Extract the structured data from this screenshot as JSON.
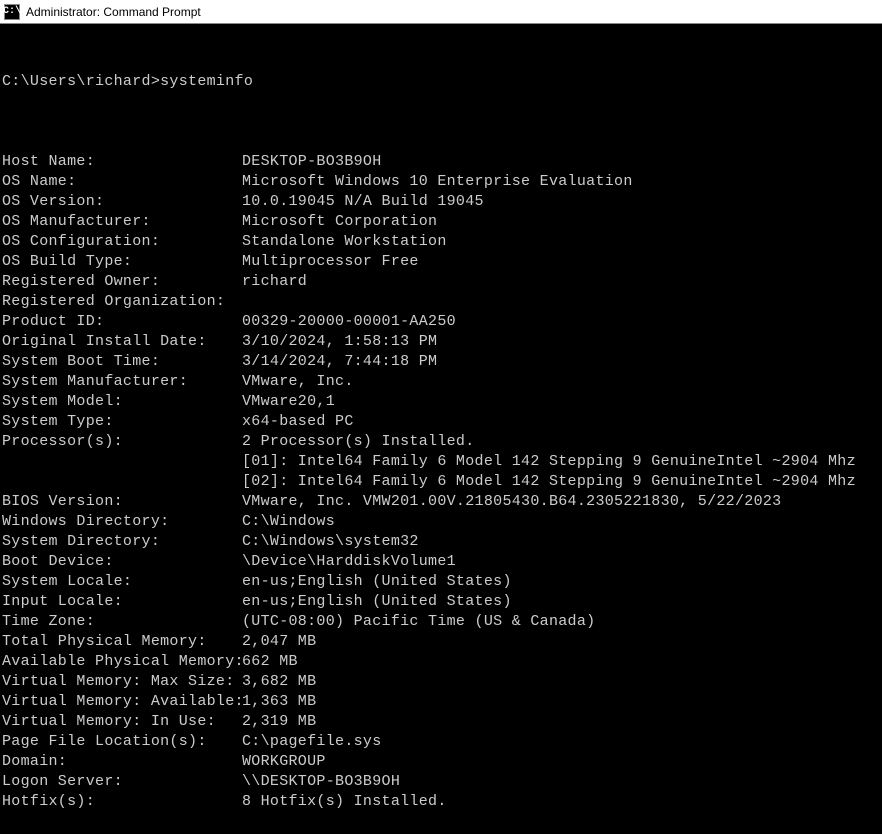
{
  "titlebar": {
    "icon_text": "C:\\",
    "title": "Administrator: Command Prompt"
  },
  "prompt": "C:\\Users\\richard>",
  "command": "systeminfo",
  "rows": [
    {
      "label": "Host Name:",
      "value": "DESKTOP-BO3B9OH"
    },
    {
      "label": "OS Name:",
      "value": "Microsoft Windows 10 Enterprise Evaluation"
    },
    {
      "label": "OS Version:",
      "value": "10.0.19045 N/A Build 19045"
    },
    {
      "label": "OS Manufacturer:",
      "value": "Microsoft Corporation"
    },
    {
      "label": "OS Configuration:",
      "value": "Standalone Workstation"
    },
    {
      "label": "OS Build Type:",
      "value": "Multiprocessor Free"
    },
    {
      "label": "Registered Owner:",
      "value": "richard"
    },
    {
      "label": "Registered Organization:",
      "value": ""
    },
    {
      "label": "Product ID:",
      "value": "00329-20000-00001-AA250"
    },
    {
      "label": "Original Install Date:",
      "value": "3/10/2024, 1:58:13 PM"
    },
    {
      "label": "System Boot Time:",
      "value": "3/14/2024, 7:44:18 PM"
    },
    {
      "label": "System Manufacturer:",
      "value": "VMware, Inc."
    },
    {
      "label": "System Model:",
      "value": "VMware20,1"
    },
    {
      "label": "System Type:",
      "value": "x64-based PC"
    },
    {
      "label": "Processor(s):",
      "value": "2 Processor(s) Installed."
    },
    {
      "label": "",
      "value": "[01]: Intel64 Family 6 Model 142 Stepping 9 GenuineIntel ~2904 Mhz"
    },
    {
      "label": "",
      "value": "[02]: Intel64 Family 6 Model 142 Stepping 9 GenuineIntel ~2904 Mhz"
    },
    {
      "label": "BIOS Version:",
      "value": "VMware, Inc. VMW201.00V.21805430.B64.2305221830, 5/22/2023"
    },
    {
      "label": "Windows Directory:",
      "value": "C:\\Windows"
    },
    {
      "label": "System Directory:",
      "value": "C:\\Windows\\system32"
    },
    {
      "label": "Boot Device:",
      "value": "\\Device\\HarddiskVolume1"
    },
    {
      "label": "System Locale:",
      "value": "en-us;English (United States)"
    },
    {
      "label": "Input Locale:",
      "value": "en-us;English (United States)"
    },
    {
      "label": "Time Zone:",
      "value": "(UTC-08:00) Pacific Time (US & Canada)"
    },
    {
      "label": "Total Physical Memory:",
      "value": "2,047 MB"
    },
    {
      "label": "Available Physical Memory:",
      "value": "662 MB"
    },
    {
      "label": "Virtual Memory: Max Size:",
      "value": "3,682 MB"
    },
    {
      "label": "Virtual Memory: Available:",
      "value": "1,363 MB"
    },
    {
      "label": "Virtual Memory: In Use:",
      "value": "2,319 MB"
    },
    {
      "label": "Page File Location(s):",
      "value": "C:\\pagefile.sys"
    },
    {
      "label": "Domain:",
      "value": "WORKGROUP"
    },
    {
      "label": "Logon Server:",
      "value": "\\\\DESKTOP-BO3B9OH"
    },
    {
      "label": "Hotfix(s):",
      "value": "8 Hotfix(s) Installed."
    }
  ]
}
